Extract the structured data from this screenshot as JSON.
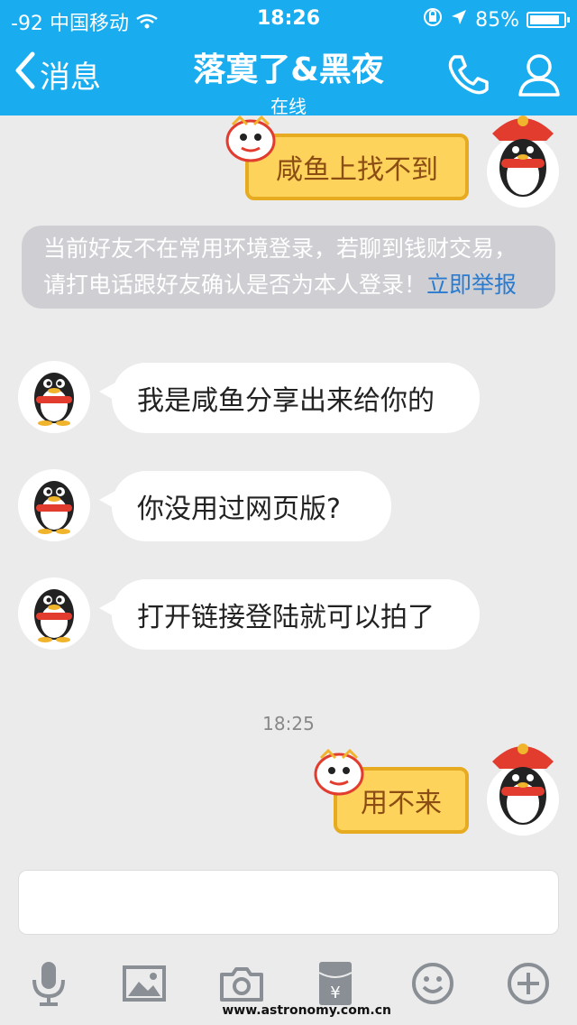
{
  "status_bar": {
    "signal": "-92",
    "carrier": "中国移动",
    "time": "18:26",
    "battery": "85%"
  },
  "header": {
    "back_label": "消息",
    "title": "落寞了&黑夜",
    "subtitle": "在线"
  },
  "messages": [
    {
      "side": "right",
      "text": "咸鱼上找不到"
    },
    {
      "side": "left",
      "text": "我是咸鱼分享出来给你的"
    },
    {
      "side": "left",
      "text": "你没用过网页版?"
    },
    {
      "side": "left",
      "text": "打开链接登陆就可以拍了"
    },
    {
      "side": "right",
      "text": "用不来"
    }
  ],
  "notice": {
    "line1": "当前好友不在常用环境登录，若聊到钱财交易，",
    "line2": "请打电话跟好友确认是否为本人登录！",
    "link": "立即举报"
  },
  "timestamp": "18:25",
  "input": {
    "value": ""
  },
  "toolbar": [
    "microphone-icon",
    "image-icon",
    "camera-icon",
    "red-packet-icon",
    "emoji-icon",
    "plus-icon"
  ],
  "watermark": "www.astronomy.com.cn",
  "colors": {
    "header": "#19adf0",
    "bubble_right": "#fdd35c",
    "bubble_right_border": "#e6ab21",
    "link": "#2b7bd0"
  }
}
